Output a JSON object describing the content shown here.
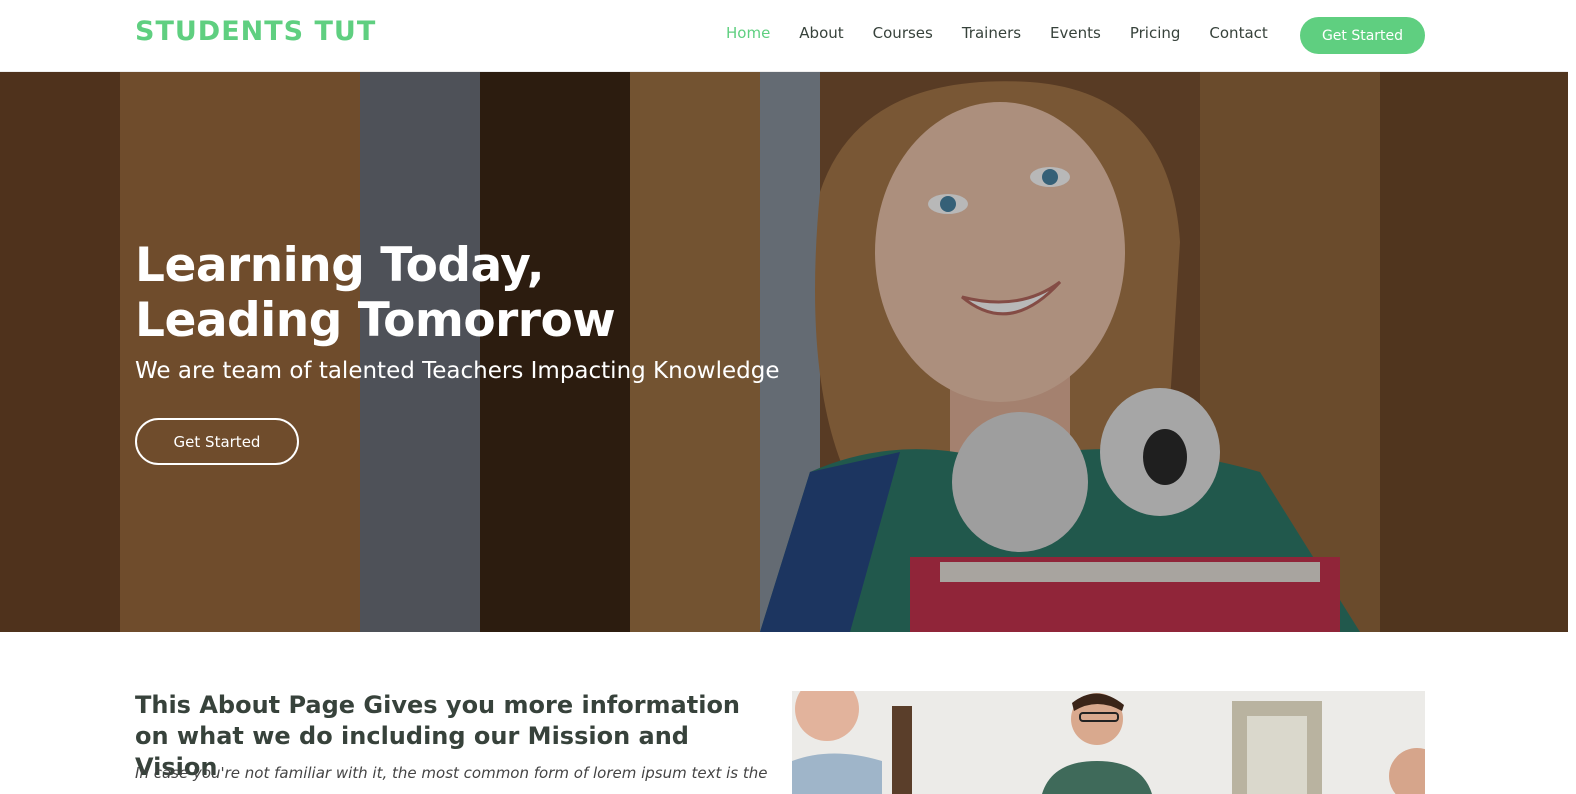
{
  "brand": {
    "logo": "STUDENTS TUT",
    "accent": "#5fcf80"
  },
  "nav": {
    "items": [
      "Home",
      "About",
      "Courses",
      "Trainers",
      "Events",
      "Pricing",
      "Contact"
    ],
    "active": "Home",
    "cta": "Get Started"
  },
  "hero": {
    "title_line1": "Learning Today,",
    "title_line2": "Leading Tomorrow",
    "subtitle": "We are team of talented Teachers Impacting Knowledge",
    "button": "Get Started",
    "image": "student-girl-with-headphones-photo"
  },
  "about": {
    "title": "This About Page Gives you more information on what we do including our Mission and Vision",
    "text": "In case you're not familiar with it, the most common form of lorem ipsum text is the",
    "image": "team-meeting-photo"
  }
}
